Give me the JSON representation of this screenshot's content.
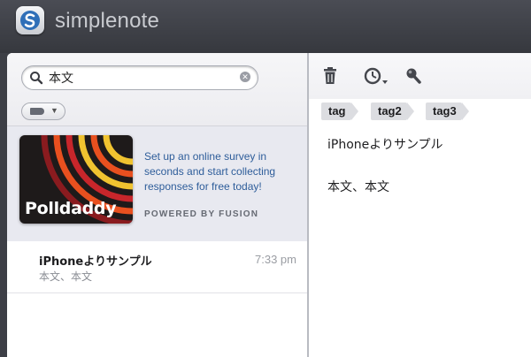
{
  "app": {
    "title": "simplenote",
    "icon": "simplenote-logo-icon"
  },
  "search": {
    "value": "本文",
    "icon": "search-icon",
    "clear_icon": "clear-icon"
  },
  "tag_filter": {
    "icon": "tag-icon",
    "caret": "chevron-down-icon"
  },
  "ad": {
    "brand": "Polldaddy",
    "text": "Set up an online survey in seconds and start collecting responses for free today!",
    "powered_by": "POWERED BY FUSION"
  },
  "notes": [
    {
      "title": "iPhoneよりサンプル",
      "preview": "本文、本文",
      "time": "7:33 pm"
    }
  ],
  "toolbar": {
    "icons": [
      "trash-icon",
      "clock-icon",
      "search-icon"
    ]
  },
  "editor": {
    "tags": [
      "tag",
      "tag2",
      "tag3"
    ],
    "body": "iPhoneよりサンプル\n\n本文、本文"
  },
  "colors": {
    "link_blue": "#2e5d9a",
    "titlebar": "#3d3f46",
    "accent_orange": "#e8501f"
  }
}
